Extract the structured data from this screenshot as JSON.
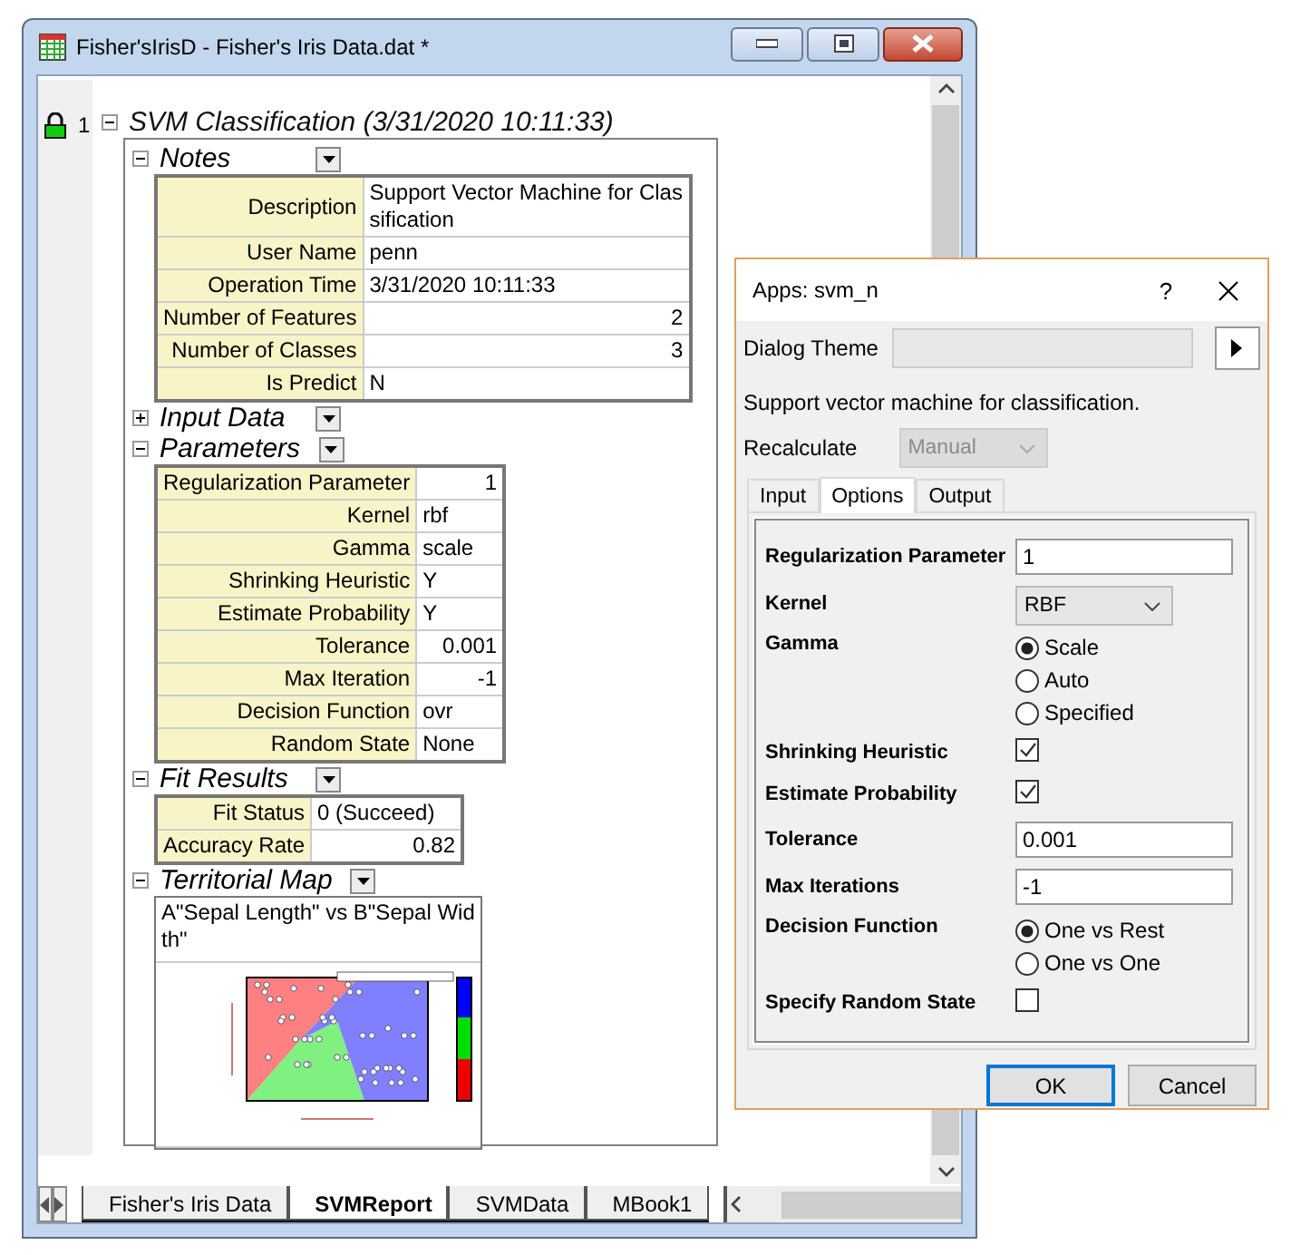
{
  "window": {
    "title": "Fisher'sIrisD - Fisher's Iris Data.dat *"
  },
  "report": {
    "index": "1",
    "title": "SVM Classification (3/31/2020 10:11:33)",
    "expanded": true,
    "sections": [
      {
        "kind": "table",
        "title": "Notes",
        "expanded": true,
        "rows": [
          {
            "label": "Description",
            "value": "Support Vector Machine for Classification",
            "kind": "text"
          },
          {
            "label": "User Name",
            "value": "penn",
            "kind": "text"
          },
          {
            "label": "Operation Time",
            "value": "3/31/2020 10:11:33",
            "kind": "text"
          },
          {
            "label": "Number of Features",
            "value": "2",
            "kind": "number"
          },
          {
            "label": "Number of Classes",
            "value": "3",
            "kind": "number"
          },
          {
            "label": "Is Predict",
            "value": "N",
            "kind": "text"
          }
        ]
      },
      {
        "title": "Input Data",
        "expanded": false
      },
      {
        "kind": "table",
        "title": "Parameters",
        "expanded": true,
        "rows": [
          {
            "label": "Regularization Parameter",
            "value": "1",
            "kind": "number"
          },
          {
            "label": "Kernel",
            "value": "rbf",
            "kind": "text"
          },
          {
            "label": "Gamma",
            "value": "scale",
            "kind": "text"
          },
          {
            "label": "Shrinking Heuristic",
            "value": "Y",
            "kind": "text"
          },
          {
            "label": "Estimate Probability",
            "value": "Y",
            "kind": "text"
          },
          {
            "label": "Tolerance",
            "value": "0.001",
            "kind": "number"
          },
          {
            "label": "Max Iteration",
            "value": "-1",
            "kind": "number"
          },
          {
            "label": "Decision Function",
            "value": "ovr",
            "kind": "text"
          },
          {
            "label": "Random State",
            "value": "None",
            "kind": "text"
          }
        ]
      },
      {
        "kind": "table",
        "title": "Fit Results",
        "expanded": true,
        "rows": [
          {
            "label": "Fit Status",
            "value": "0 (Succeed)",
            "kind": "text"
          },
          {
            "label": "Accuracy Rate",
            "value": "0.82",
            "kind": "number"
          }
        ]
      },
      {
        "kind": "graph",
        "title": "Territorial Map",
        "expanded": true,
        "caption": "A\"Sepal Length\" vs B\"Sepal Width\""
      }
    ]
  },
  "sheets": [
    {
      "label": "Fisher's Iris Data",
      "selected": false
    },
    {
      "label": "SVMReport",
      "selected": true
    },
    {
      "label": "SVMData",
      "selected": false
    },
    {
      "label": "MBook1",
      "selected": false
    }
  ],
  "dialog": {
    "title": "Apps: svm_n",
    "help": "?",
    "theme_label": "Dialog Theme",
    "description": "Support vector machine for classification.",
    "recalculate": {
      "label": "Recalculate",
      "value": "Manual",
      "disabled": true
    },
    "tabs": [
      {
        "label": "Input",
        "selected": false
      },
      {
        "label": "Options",
        "selected": true
      },
      {
        "label": "Output",
        "selected": false
      }
    ],
    "options": [
      {
        "kind": "text",
        "label": "Regularization Parameter",
        "value": "1"
      },
      {
        "kind": "select",
        "label": "Kernel",
        "value": "RBF"
      },
      {
        "kind": "radio",
        "label": "Gamma",
        "choices": [
          {
            "label": "Scale",
            "selected": true
          },
          {
            "label": "Auto",
            "selected": false
          },
          {
            "label": "Specified",
            "selected": false
          }
        ]
      },
      {
        "kind": "checkbox",
        "label": "Shrinking Heuristic",
        "checked": true
      },
      {
        "kind": "checkbox",
        "label": "Estimate Probability",
        "checked": true
      },
      {
        "kind": "text",
        "label": "Tolerance",
        "value": "0.001"
      },
      {
        "kind": "text",
        "label": "Max Iterations",
        "value": "-1"
      },
      {
        "kind": "radio",
        "label": "Decision Function",
        "choices": [
          {
            "label": "One vs Rest",
            "selected": true
          },
          {
            "label": "One vs One",
            "selected": false
          }
        ]
      },
      {
        "kind": "checkbox",
        "label": "Specify Random State",
        "checked": false
      }
    ],
    "buttons": [
      {
        "label": "OK",
        "default": true
      },
      {
        "label": "Cancel",
        "default": false
      }
    ]
  }
}
